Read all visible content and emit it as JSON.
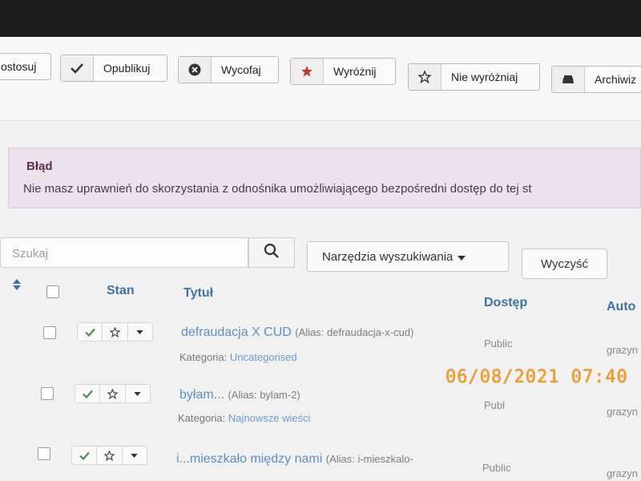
{
  "toolbar": {
    "apply_label": "ostosuj",
    "publish_label": "Opublikuj",
    "unpublish_label": "Wycofaj",
    "feature_label": "Wyróżnij",
    "unfeature_label": "Nie wyróżniaj",
    "archive_label": "Archiwiz"
  },
  "alert": {
    "heading": "Błąd",
    "message": "Nie masz uprawnień do skorzystania z odnośnika umożliwiającego bezpośredni dostęp do tej st"
  },
  "search": {
    "placeholder": "Szukaj",
    "tools_label": "Narzędzia wyszukiwania",
    "clear_label": "Wyczyść"
  },
  "table": {
    "headers": {
      "status": "Stan",
      "title": "Tytuł",
      "access": "Dostęp",
      "author": "Auto"
    },
    "rows": [
      {
        "title": "defraudacja X CUD",
        "alias": "(Alias: defraudacja-x-cud)",
        "category_label": "Kategoria:",
        "category": "Uncategorised",
        "access": "Public",
        "author": "grazyn"
      },
      {
        "title": "byłam...",
        "alias": "(Alias: bylam-2)",
        "category_label": "Kategoria:",
        "category": "Najnowsze wieści",
        "access": "Publ",
        "author": "grazyn"
      },
      {
        "title": "i...mieszkało między nami",
        "alias": "(Alias: i-mieszkalo-",
        "category_label": "",
        "category": "",
        "access": "Public",
        "author": "grazyn"
      }
    ]
  },
  "timestamp": "06/08/2021  07:40",
  "colors": {
    "accent": "#3f73a7",
    "link": "#5b8fc6",
    "alert_bg": "#ede1ec",
    "check": "#4e8a4e",
    "star": "#c0392b"
  }
}
